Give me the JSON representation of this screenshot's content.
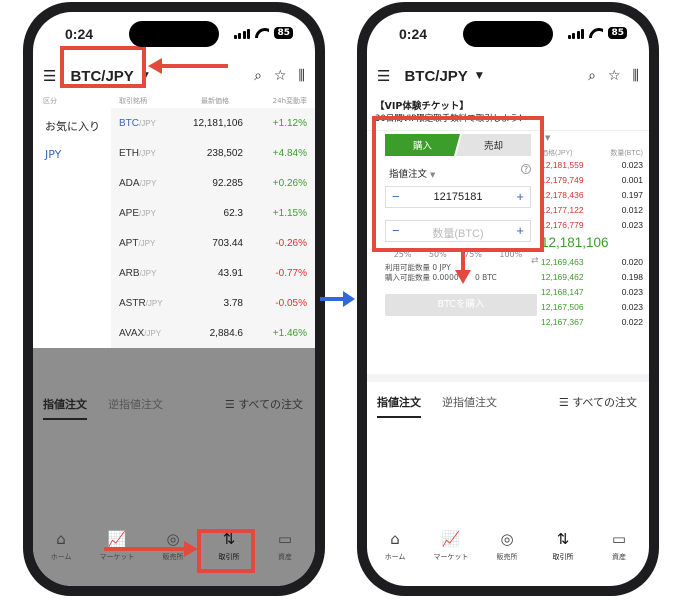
{
  "status": {
    "time": "0:24",
    "battery": "85"
  },
  "header": {
    "pair": "BTC/JPY"
  },
  "left": {
    "columns": [
      "区分",
      "取引銘柄",
      "最新価格",
      "24h変動率"
    ],
    "categories": [
      "お気に入り",
      "JPY"
    ],
    "rows": [
      {
        "base": "BTC",
        "quote": "/JPY",
        "price": "12,181,106",
        "change": "+1.12%"
      },
      {
        "base": "ETH",
        "quote": "/JPY",
        "price": "238,502",
        "change": "+4.84%"
      },
      {
        "base": "ADA",
        "quote": "/JPY",
        "price": "92.285",
        "change": "+0.26%"
      },
      {
        "base": "APE",
        "quote": "/JPY",
        "price": "62.3",
        "change": "+1.15%"
      },
      {
        "base": "APT",
        "quote": "/JPY",
        "price": "703.44",
        "change": "-0.26%"
      },
      {
        "base": "ARB",
        "quote": "/JPY",
        "price": "43.91",
        "change": "-0.77%"
      },
      {
        "base": "ASTR",
        "quote": "/JPY",
        "price": "3.78",
        "change": "-0.05%"
      },
      {
        "base": "AVAX",
        "quote": "/JPY",
        "price": "2,884.6",
        "change": "+1.46%"
      }
    ]
  },
  "tabs": {
    "limit": "指値注文",
    "stop": "逆指値注文",
    "all": "すべての注文"
  },
  "nav": [
    "ホーム",
    "マーケット",
    "販売所",
    "取引所",
    "資産"
  ],
  "right": {
    "ticket_title": "【VIP体験チケット】",
    "ticket_sub": "30日間VIP限定取手数料で取引しよう！",
    "buy": "購入",
    "sell": "売却",
    "order_type": "指値注文",
    "price_value": "12175181",
    "qty_placeholder": "数量(BTC)",
    "pcts": [
      "25%",
      "50%",
      "75%",
      "100%"
    ],
    "avail1": "利用可能数量 0 JPY",
    "avail2": "購入可能数量 0.0000",
    "avail2b": "0 BTC",
    "cta": "BTCを購入",
    "ob_head": [
      "価格(JPY)",
      "数量(BTC)"
    ],
    "asks": [
      {
        "p": "12,181,559",
        "q": "0.023"
      },
      {
        "p": "12,179,749",
        "q": "0.001"
      },
      {
        "p": "12,178,436",
        "q": "0.197"
      },
      {
        "p": "12,177,122",
        "q": "0.012"
      },
      {
        "p": "12,176,779",
        "q": "0.023"
      }
    ],
    "mid": "12,181,106",
    "bids": [
      {
        "p": "12,169,463",
        "q": "0.020"
      },
      {
        "p": "12,169,462",
        "q": "0.198"
      },
      {
        "p": "12,168,147",
        "q": "0.023"
      },
      {
        "p": "12,167,506",
        "q": "0.023"
      },
      {
        "p": "12,167,367",
        "q": "0.022"
      }
    ]
  }
}
